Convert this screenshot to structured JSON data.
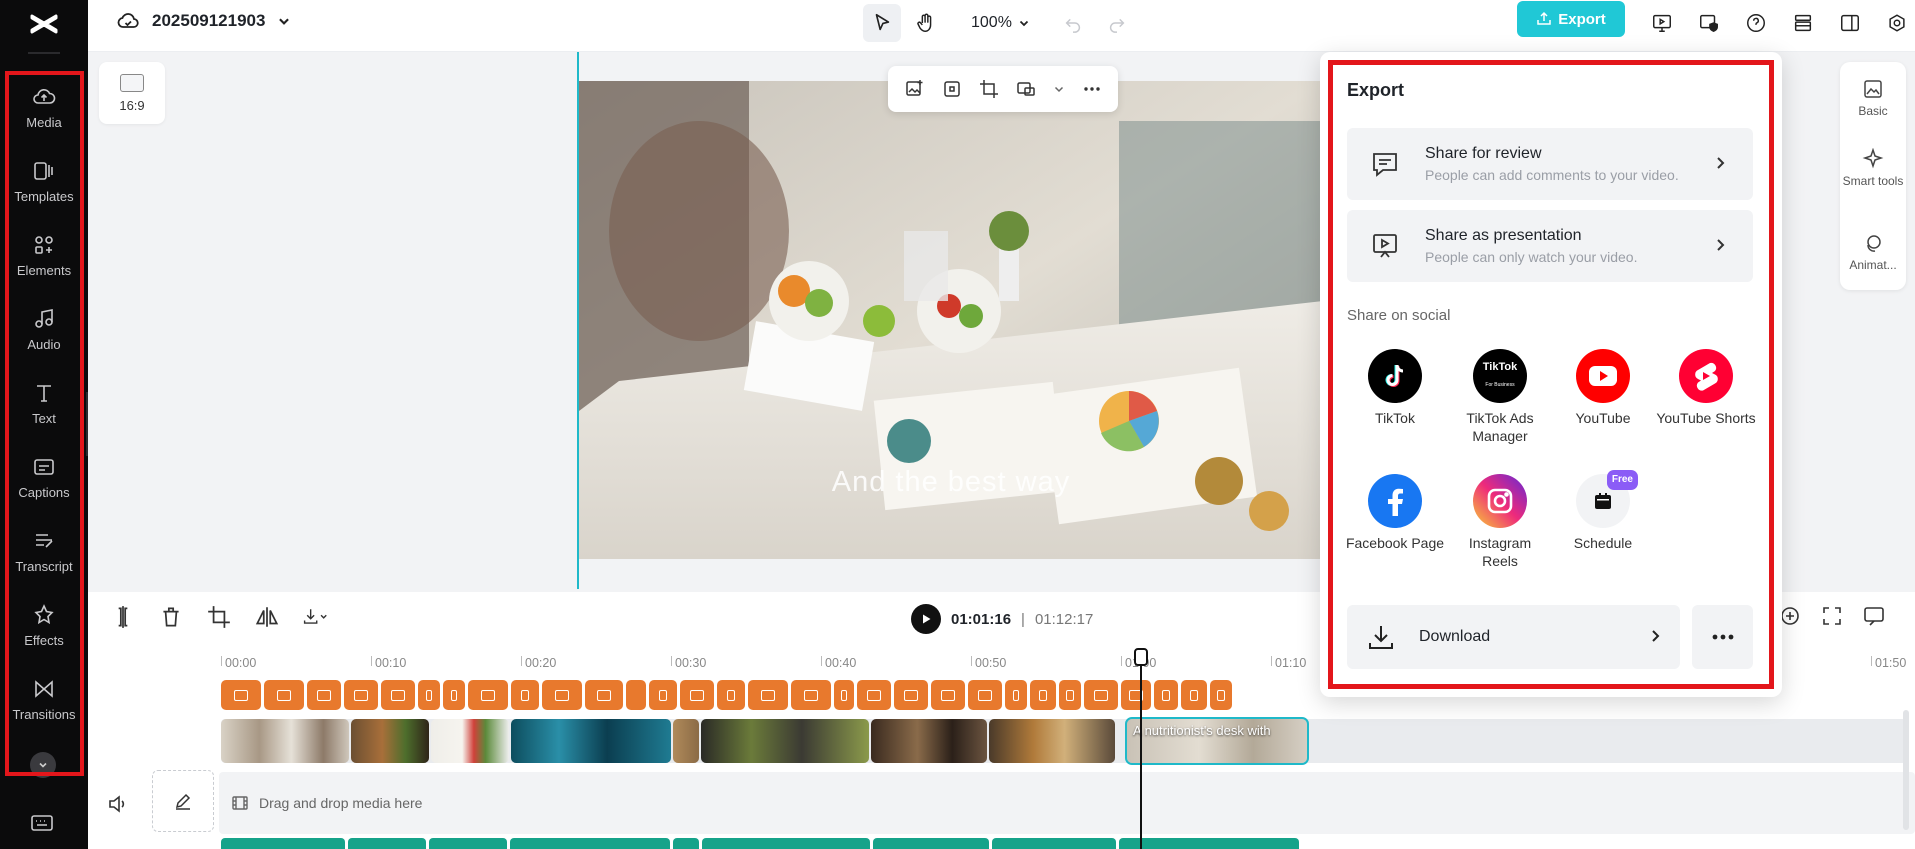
{
  "app": {
    "project_name": "202509121903"
  },
  "topbar": {
    "zoom": "100%",
    "export_label": "Export"
  },
  "sidebar": {
    "items": [
      {
        "label": "Media",
        "icon": "media-icon"
      },
      {
        "label": "Templates",
        "icon": "templates-icon"
      },
      {
        "label": "Elements",
        "icon": "elements-icon"
      },
      {
        "label": "Audio",
        "icon": "audio-icon"
      },
      {
        "label": "Text",
        "icon": "text-icon"
      },
      {
        "label": "Captions",
        "icon": "captions-icon"
      },
      {
        "label": "Transcript",
        "icon": "transcript-icon"
      },
      {
        "label": "Effects",
        "icon": "effects-icon"
      },
      {
        "label": "Transitions",
        "icon": "transitions-icon"
      }
    ]
  },
  "canvas": {
    "aspect_ratio": "16:9",
    "caption_text": "And the best way"
  },
  "right_rail": {
    "items": [
      {
        "label": "Basic",
        "icon": "basic-icon"
      },
      {
        "label": "Smart tools",
        "icon": "smart-tools-icon"
      },
      {
        "label": "Animat...",
        "icon": "animation-icon"
      }
    ]
  },
  "playback": {
    "current_time": "01:01:16",
    "separator": "|",
    "total_time": "01:12:17"
  },
  "timeline": {
    "ruler": [
      "00:00",
      "00:10",
      "00:20",
      "00:30",
      "00:40",
      "00:50",
      "01:00",
      "01:10",
      "01:50"
    ],
    "selected_clip_label": "A nutritionist's desk with",
    "drop_hint": "Drag and drop media here"
  },
  "export_panel": {
    "title": "Export",
    "share_review": {
      "title": "Share for review",
      "desc": "People can add comments to your video."
    },
    "share_presentation": {
      "title": "Share as presentation",
      "desc": "People can only watch your video."
    },
    "social_heading": "Share on social",
    "social": [
      {
        "label": "TikTok",
        "color": "#000000"
      },
      {
        "label": "TikTok Ads Manager",
        "color": "#000000"
      },
      {
        "label": "YouTube",
        "color": "#ff0000"
      },
      {
        "label": "YouTube Shorts",
        "color": "#ff0033"
      },
      {
        "label": "Facebook Page",
        "color": "#1877f2"
      },
      {
        "label": "Instagram Reels",
        "color": "#d62976"
      },
      {
        "label": "Schedule",
        "color": "#f2f3f5",
        "badge": "Free"
      }
    ],
    "tiktok_ads_logo": "TikTok",
    "tiktok_ads_logo_sub": "For Business",
    "download_label": "Download"
  },
  "colors": {
    "accent": "#20c8d6",
    "highlight_border": "#e3161b",
    "caption_clip": "#e8792d",
    "audio_clip": "#16a38a"
  }
}
